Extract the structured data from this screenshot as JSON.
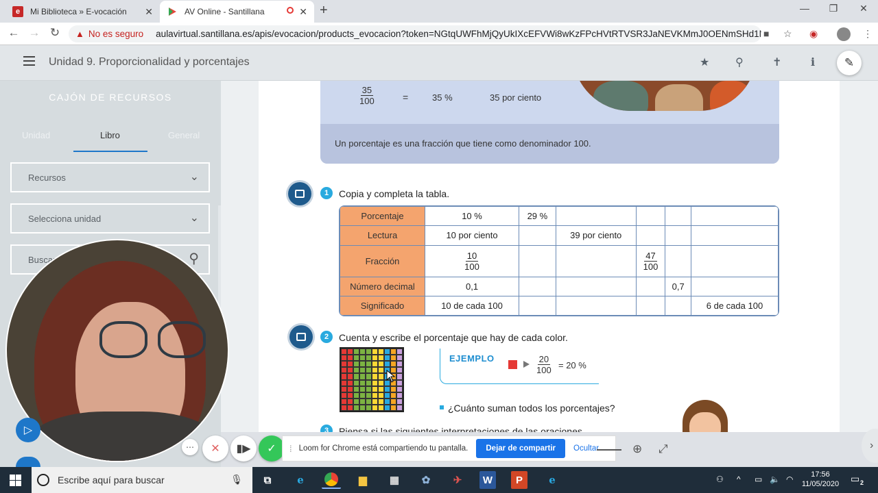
{
  "browser": {
    "tabs": [
      {
        "title": "Mi Biblioteca » E-vocación",
        "favicon": "e"
      },
      {
        "title": "AV Online - Santillana",
        "favicon": "play"
      }
    ],
    "new_tab": "+",
    "security_label": "No es seguro",
    "url": "aulavirtual.santillana.es/apis/evocacion/products_evocacion?token=NGtqUWFhMjQyUkIXcEFVWi8wKzFPcHVtRTVSR3JaNEVKMmJ0OENmSHd1N1lkN..."
  },
  "app": {
    "title": "Unidad 9. Proporcionalidad y porcentajes"
  },
  "sidebar": {
    "heading": "CAJÓN DE RECURSOS",
    "tabs": [
      "Unidad",
      "Libro",
      "General"
    ],
    "active_tab": "Libro",
    "recursos_label": "Recursos",
    "unidad_label": "Selecciona unidad",
    "search_placeholder": "Buscar"
  },
  "book": {
    "top_fraction": {
      "num": "35",
      "den": "100"
    },
    "equals": "=",
    "top_percent": "35 %",
    "top_words": "35 por ciento",
    "definition": "Un porcentaje es una fracción que tiene como denominador 100.",
    "q1": {
      "num": "1",
      "title": "Copia y completa la tabla."
    },
    "table": {
      "rows": [
        {
          "header": "Porcentaje",
          "cells": [
            "10 %",
            "29 %",
            "",
            "",
            "",
            ""
          ]
        },
        {
          "header": "Lectura",
          "cells": [
            "10 por ciento",
            "",
            "39 por ciento",
            "",
            "",
            ""
          ]
        },
        {
          "header": "Fracción",
          "cells": [
            "",
            "",
            "",
            "",
            "",
            ""
          ],
          "fractions": [
            {
              "col": 0,
              "num": "10",
              "den": "100"
            },
            {
              "col": 3,
              "num": "47",
              "den": "100"
            }
          ]
        },
        {
          "header": "Número decimal",
          "cells": [
            "0,1",
            "",
            "",
            "",
            "0,7",
            ""
          ]
        },
        {
          "header": "Significado",
          "cells": [
            "10 de cada 100",
            "",
            "",
            "",
            "",
            "6 de cada 100"
          ]
        }
      ]
    },
    "q2": {
      "num": "2",
      "title": "Cuenta y escribe el porcentaje que hay de cada color."
    },
    "grid_colors": [
      "#e53935",
      "#e53935",
      "#7cb342",
      "#7cb342",
      "#7cb342",
      "#fdd835",
      "#fdd835",
      "#29a8e0",
      "#f5a623",
      "#c9a0dc"
    ],
    "ejemplo": {
      "label": "EJEMPLO",
      "num": "20",
      "den": "100",
      "result": "= 20 %"
    },
    "question_sum": "¿Cuánto suman todos los porcentajes?",
    "q3": {
      "num": "3",
      "title": "Piensa si las siguientes interpretaciones de las oraciones"
    }
  },
  "loom": {
    "message": "Loom for Chrome está compartiendo tu pantalla.",
    "stop_label": "Dejar de compartir",
    "hide_label": "Ocultar"
  },
  "taskbar": {
    "search_placeholder": "Escribe aquí para buscar",
    "time": "17:56",
    "date": "11/05/2020",
    "notifications": "2"
  },
  "colors": {
    "accent": "#1e77c9",
    "table_header": "#f4a46e",
    "question_badge": "#29aadf"
  }
}
